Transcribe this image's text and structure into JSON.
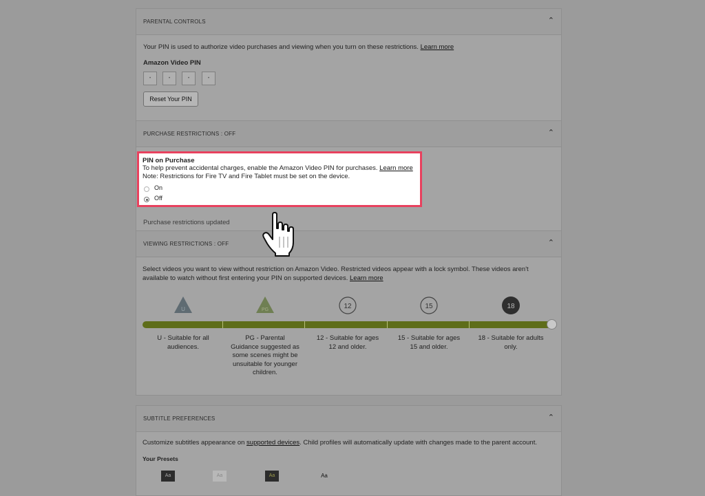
{
  "parental_controls": {
    "header": "PARENTAL CONTROLS",
    "description": "Your PIN is used to authorize video purchases and viewing when you turn on these restrictions.",
    "learn_more": "Learn more",
    "pin_label": "Amazon Video PIN",
    "pin_digits": [
      "•",
      "•",
      "•",
      "•"
    ],
    "reset_button": "Reset Your PIN"
  },
  "purchase_restrictions": {
    "header": "PURCHASE RESTRICTIONS : OFF",
    "title": "PIN on Purchase",
    "description": "To help prevent accidental charges, enable the Amazon Video PIN for purchases.",
    "learn_more": "Learn more",
    "note": "Note: Restrictions for Fire TV and Fire Tablet must be set on the device.",
    "options": [
      {
        "label": "On",
        "selected": false
      },
      {
        "label": "Off",
        "selected": true
      }
    ],
    "status": "Purchase restrictions updated"
  },
  "viewing_restrictions": {
    "header": "VIEWING RESTRICTIONS : OFF",
    "description_line1": "Select videos you want to view without restriction on Amazon Video. Restricted videos appear with a lock symbol. These videos aren't",
    "description_line2": "available to watch without first entering your PIN on supported devices.",
    "learn_more": "Learn more",
    "slider_value": "18",
    "ratings": [
      {
        "badge": "U",
        "shape": "triangle",
        "description": "U - Suitable for all audiences."
      },
      {
        "badge": "PG",
        "shape": "triangle",
        "description": "PG - Parental Guidance suggested as some scenes might be unsuitable for younger children."
      },
      {
        "badge": "12",
        "shape": "circle-outline",
        "description": "12 - Suitable for ages 12 and older."
      },
      {
        "badge": "15",
        "shape": "circle-outline",
        "description": "15 - Suitable for ages 15 and older."
      },
      {
        "badge": "18",
        "shape": "circle-filled",
        "description": "18 - Suitable for adults only."
      }
    ]
  },
  "subtitle_preferences": {
    "header": "SUBTITLE PREFERENCES",
    "description_pre": "Customize subtitles appearance on",
    "supported_devices": "supported devices",
    "description_post": ". Child profiles will automatically update with changes made to the parent account.",
    "presets_label": "Your Presets",
    "presets": [
      "Aa",
      "Aa",
      "Aa",
      "Aa"
    ]
  },
  "colors": {
    "highlight_border": "#e8415e",
    "slider_green": "#5e6d1a",
    "overlay_gray": "#9b9b9b"
  }
}
